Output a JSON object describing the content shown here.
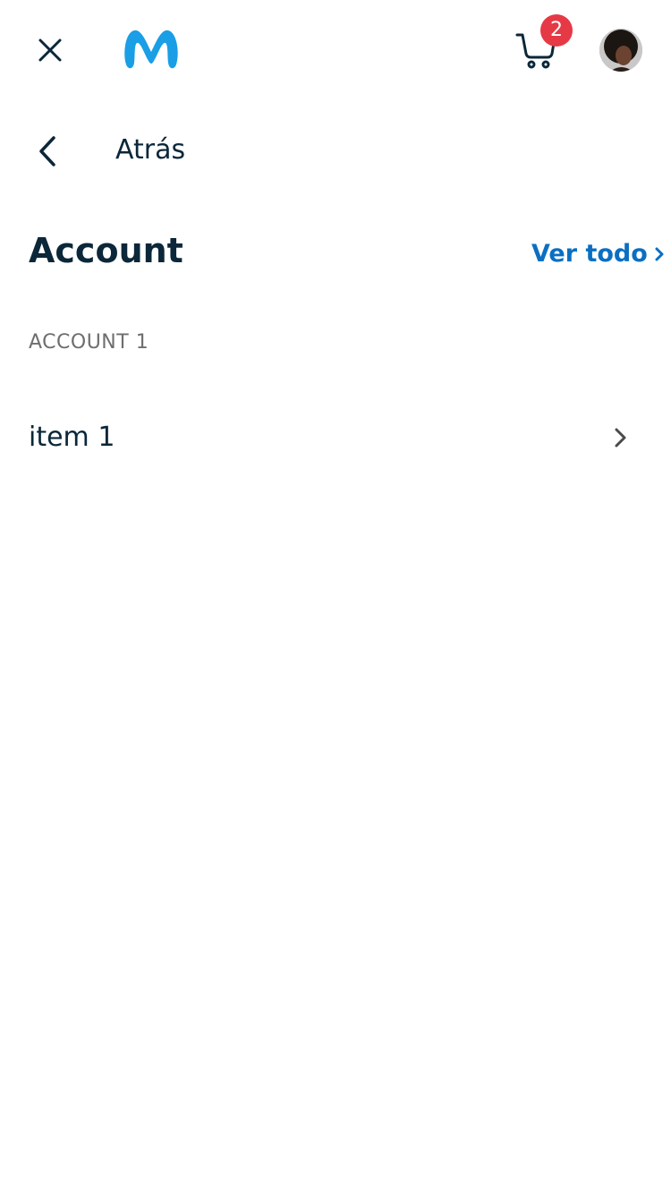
{
  "header": {
    "close_icon": "close-icon",
    "logo": "movistar-m-logo",
    "cart_icon": "cart-icon",
    "cart_count": "2",
    "avatar": "user-avatar"
  },
  "nav": {
    "back_label": "Atrás",
    "back_icon": "chevron-left-icon"
  },
  "section": {
    "title": "Account",
    "see_all_label": "Ver todo",
    "see_all_icon": "chevron-right-icon"
  },
  "group": {
    "label": "ACCOUNT 1",
    "items": [
      {
        "label": "item 1",
        "icon": "chevron-right-icon"
      }
    ]
  },
  "colors": {
    "text_primary": "#0b2739",
    "link": "#0a6fc2",
    "brand": "#1a9ee6",
    "badge": "#e63946",
    "muted": "#6e6e6e"
  }
}
